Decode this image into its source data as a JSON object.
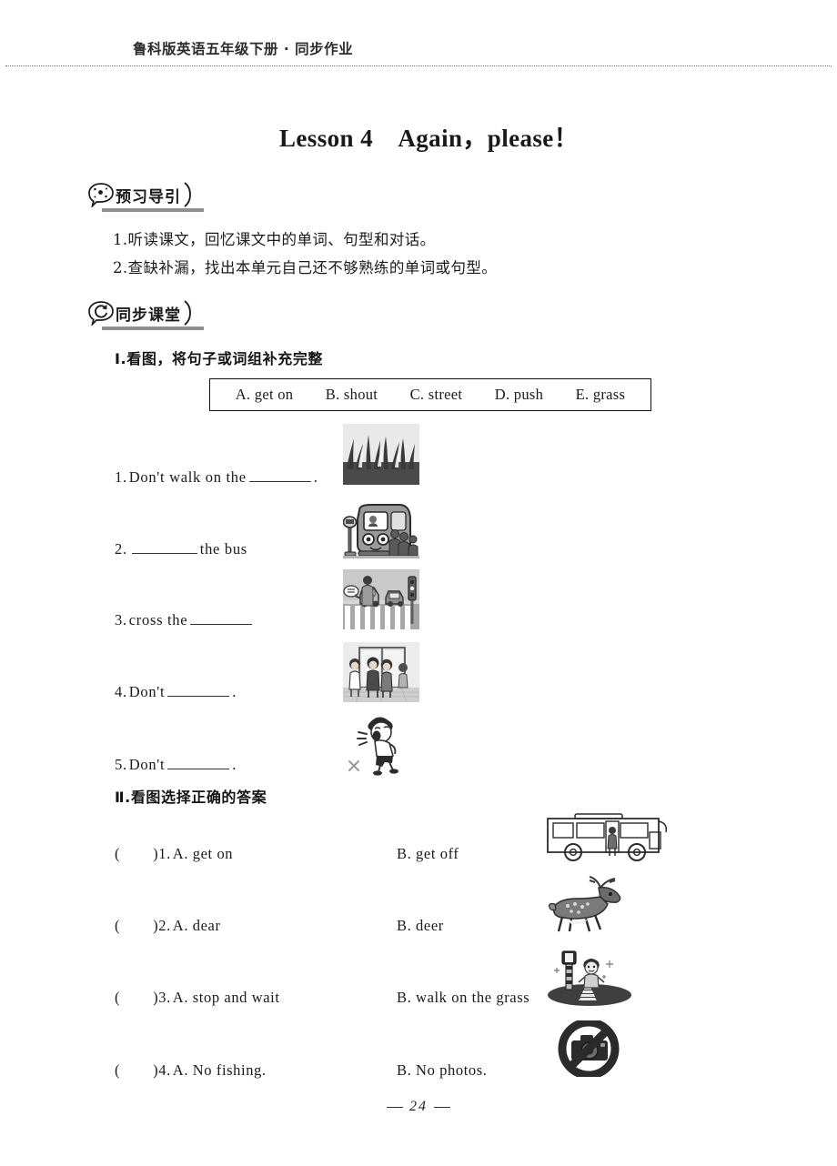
{
  "header": {
    "book_line": "鲁科版英语五年级下册 · 同步作业"
  },
  "title": "Lesson 4　Again，please！",
  "sections": {
    "preview": {
      "badge_label": "预习导引",
      "badge_icon": "sparkle-bubble-icon",
      "lines": [
        "1.听读课文，回忆课文中的单词、句型和对话。",
        "2.查缺补漏，找出本单元自己还不够熟练的单词或句型。"
      ]
    },
    "classroom": {
      "badge_label": "同步课堂",
      "badge_icon": "refresh-bubble-icon"
    }
  },
  "exercise_one": {
    "heading": "Ⅰ.看图，将句子或词组补充完整",
    "word_bank": [
      "A. get on",
      "B. shout",
      "C. street",
      "D. push",
      "E. grass"
    ],
    "questions": [
      {
        "number": "1.",
        "before": "Don't walk on the",
        "after": ".",
        "picture": "grass-picture"
      },
      {
        "number": "2.",
        "before": "",
        "after": "the bus",
        "picture": "bus-boarding-picture"
      },
      {
        "number": "3.",
        "before": "cross the",
        "after": "",
        "picture": "crosswalk-picture"
      },
      {
        "number": "4.",
        "before": "Don't",
        "after": ".",
        "picture": "children-pushing-picture"
      },
      {
        "number": "5.",
        "before": "Don't",
        "after": ".",
        "picture": "shouting-boy-picture"
      }
    ]
  },
  "exercise_two": {
    "heading": "Ⅱ.看图选择正确的答案",
    "questions": [
      {
        "paren_open": "(",
        "paren_close": ")",
        "number": "1.",
        "option_a": "A. get on",
        "option_b": "B. get off",
        "picture": "city-bus-picture"
      },
      {
        "paren_open": "(",
        "paren_close": ")",
        "number": "2.",
        "option_a": "A. dear",
        "option_b": "B. deer",
        "picture": "deer-picture"
      },
      {
        "paren_open": "(",
        "paren_close": ")",
        "number": "3.",
        "option_a": "A. stop and wait",
        "option_b": "B. walk on the grass",
        "picture": "traffic-light-picture"
      },
      {
        "paren_open": "(",
        "paren_close": ")",
        "number": "4.",
        "option_a": "A. No fishing.",
        "option_b": "B. No photos.",
        "picture": "no-photos-sign-picture"
      }
    ]
  },
  "footer": {
    "page_number": "24"
  }
}
